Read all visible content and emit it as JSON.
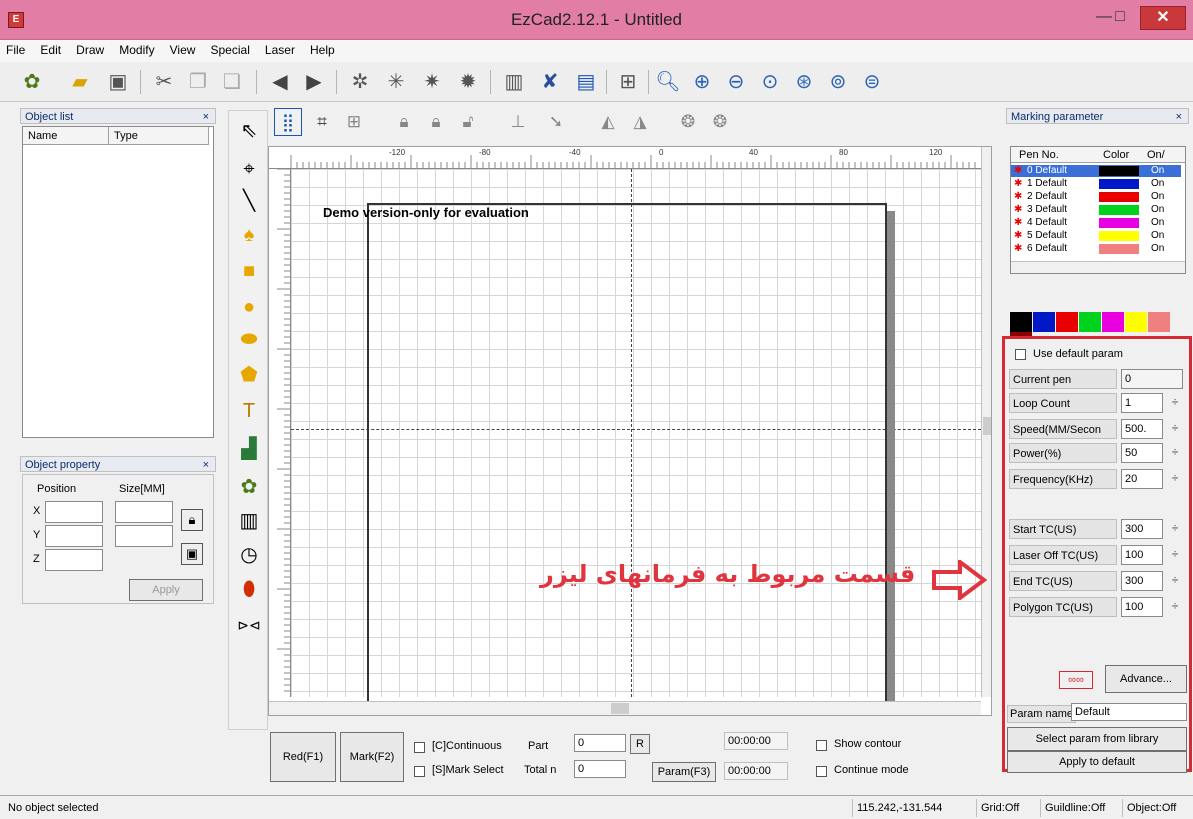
{
  "window": {
    "title": "EzCad2.12.1 - Untitled",
    "app_icon": "E",
    "minimize": "—",
    "maximize": "□",
    "close": "✕"
  },
  "menu": [
    "File",
    "Edit",
    "Draw",
    "Modify",
    "View",
    "Special",
    "Laser",
    "Help"
  ],
  "toolbar_icons": [
    "new-file-icon",
    "open-folder-icon",
    "save-icon",
    "cut-icon",
    "copy-icon",
    "paste-icon",
    "back-icon",
    "forward-icon",
    "select-node-icon",
    "select-group-icon",
    "combine-icon",
    "uncombine-icon",
    "hatch-icon",
    "tools-icon",
    "document-icon",
    "grid-icon",
    "zoom-icon",
    "zoom-in-icon",
    "zoom-out-icon",
    "zoom-fit-icon",
    "zoom-all-icon",
    "zoom-prev-icon",
    "zoom-select-icon"
  ],
  "object_list": {
    "title": "Object list",
    "close": "×",
    "col_name": "Name",
    "col_type": "Type"
  },
  "object_property": {
    "title": "Object property",
    "close": "×",
    "position": "Position",
    "size": "Size[MM]",
    "x": "X",
    "y": "Y",
    "z": "Z",
    "apply": "Apply"
  },
  "canvas": {
    "demo_text": "Demo version-only for evaluation",
    "ruler_labels": [
      "-120",
      "-80",
      "-40",
      "0",
      "40",
      "80",
      "120"
    ]
  },
  "bottom": {
    "red": "Red(F1)",
    "mark": "Mark(F2)",
    "continuous": "[C]Continuous",
    "mark_select": "[S]Mark Select",
    "part_label": "Part",
    "part_value": "0",
    "total_label": "Total n",
    "total_value": "0",
    "r": "R",
    "time1": "00:00:00",
    "time2": "00:00:00",
    "param": "Param(F3)",
    "show_contour": "Show contour",
    "continue_mode": "Continue mode"
  },
  "status": {
    "message": "No object selected",
    "coords": "115.242,-131.544",
    "grid": "Grid:Off",
    "guideline": "Guildline:Off",
    "object": "Object:Off"
  },
  "marking": {
    "title": "Marking parameter",
    "close": "×",
    "pen_header": {
      "pen_no": "Pen No.",
      "color": "Color",
      "on": "On/"
    },
    "pens": [
      {
        "name": "0 Default",
        "color": "#000000",
        "on": "On"
      },
      {
        "name": "1 Default",
        "color": "#0018c8",
        "on": "On"
      },
      {
        "name": "2 Default",
        "color": "#e80000",
        "on": "On"
      },
      {
        "name": "3 Default",
        "color": "#00d21e",
        "on": "On"
      },
      {
        "name": "4 Default",
        "color": "#e800e0",
        "on": "On"
      },
      {
        "name": "5 Default",
        "color": "#ffff00",
        "on": "On"
      },
      {
        "name": "6 Default",
        "color": "#f08080",
        "on": "On"
      }
    ],
    "strip": [
      "#000000",
      "#0018c8",
      "#e80000",
      "#00d21e",
      "#e800e0",
      "#ffff00",
      "#f08080",
      "#8b0000"
    ],
    "use_default": "Use default param",
    "params": [
      {
        "label": "Current pen",
        "value": "0",
        "spin": false
      },
      {
        "label": "Loop Count",
        "value": "1",
        "spin": true
      },
      {
        "label": "Speed(MM/Secon",
        "value": "500.",
        "spin": true
      },
      {
        "label": "Power(%)",
        "value": "50",
        "spin": true
      },
      {
        "label": "Frequency(KHz)",
        "value": "20",
        "spin": true
      },
      {
        "label": "Start TC(US)",
        "value": "300",
        "spin": true
      },
      {
        "label": "Laser Off TC(US)",
        "value": "100",
        "spin": true
      },
      {
        "label": "End TC(US)",
        "value": "300",
        "spin": true
      },
      {
        "label": "Polygon TC(US)",
        "value": "100",
        "spin": true
      }
    ],
    "advance": "Advance...",
    "param_name_label": "Param name",
    "param_name_value": "Default",
    "select_library": "Select param from library",
    "apply_default": "Apply to default"
  },
  "annotation": {
    "text": "قسمت مربوط به فرمانهای لیزر",
    "color": "#e0343e"
  }
}
